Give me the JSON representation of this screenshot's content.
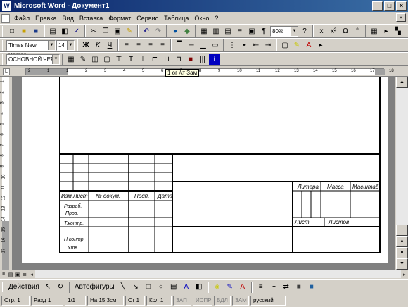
{
  "window": {
    "title": "Microsoft Word - Документ1",
    "icon": "W"
  },
  "menu": [
    "Файл",
    "Правка",
    "Вид",
    "Вставка",
    "Формат",
    "Сервис",
    "Таблица",
    "Окно",
    "?"
  ],
  "formatting": {
    "style": "Обычный",
    "font": "Times New Roman",
    "size": "14",
    "zoom": "80%"
  },
  "tables_toolbar": {
    "style": "ОСНОВНОЙ ЧЕР"
  },
  "ruler": {
    "tooltip": "1  ог Ат Зам",
    "ticks": [
      "2",
      "1",
      "1",
      "2",
      "3",
      "4",
      "5",
      "6",
      "7",
      "8",
      "9",
      "10",
      "11",
      "12",
      "13",
      "14",
      "15",
      "16",
      "17",
      "18"
    ]
  },
  "vruler": {
    "ticks": [
      "1",
      "2",
      "3",
      "4",
      "5",
      "6",
      "7",
      "8",
      "9",
      "10",
      "11",
      "12",
      "13",
      "14",
      "15",
      "16",
      "17"
    ]
  },
  "stamp": {
    "headers": [
      "Изм",
      "Лист",
      "№ докум.",
      "Подп.",
      "Дата"
    ],
    "rows": [
      "Разраб.",
      "Пров.",
      "Т.контр.",
      "Н.контр.",
      "Утв."
    ],
    "right_headers": [
      "Литера",
      "Масса",
      "Масштаб"
    ],
    "sheet": "Лист",
    "sheets": "Листов"
  },
  "drawing": {
    "actions": "Действия",
    "autoshapes": "Автофигуры"
  },
  "status": {
    "page": "Стр. 1",
    "section": "Разд 1",
    "pages": "1/1",
    "pos": "На 15,3см",
    "line": "Ст 1",
    "col": "Кол 1",
    "rec": "ЗАП",
    "trk": "ИСПР",
    "ext": "ВДЛ",
    "ovr": "ЗАМ",
    "lang": "русский"
  }
}
